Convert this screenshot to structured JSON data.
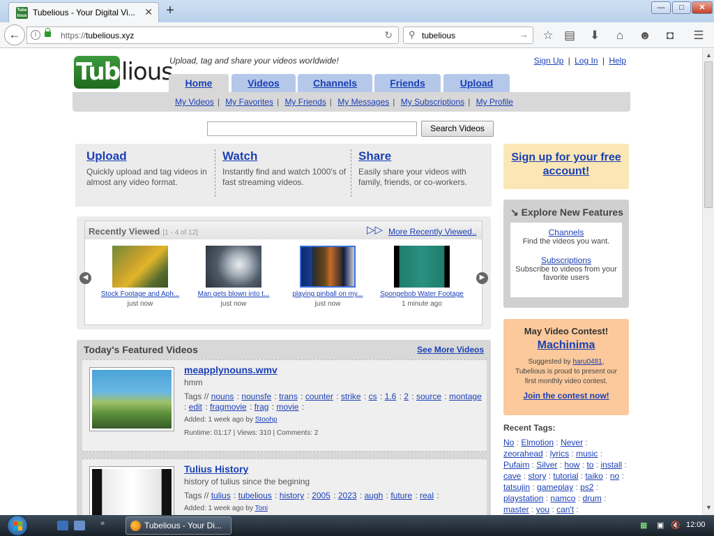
{
  "browser": {
    "tab_title": "Tubelious - Your Digital Vi...",
    "favicon_text": "Tube lious",
    "url_prefix": "https://",
    "url_host": "tubelious.xyz",
    "search_value": "tubelious",
    "window_buttons": {
      "minimize": "—",
      "maximize": "□",
      "close": "✕"
    }
  },
  "site": {
    "logo_left": "Tube",
    "logo_right": "lious",
    "tagline": "Upload, tag and share your videos worldwide!",
    "account": {
      "sign_up": "Sign Up",
      "log_in": "Log In",
      "help": "Help",
      "sep": "|"
    },
    "tabs": [
      "Home",
      "Videos",
      "Channels",
      "Friends",
      "Upload"
    ],
    "subnav": [
      "My Videos",
      "My Favorites",
      "My Friends",
      "My Messages",
      "My Subscriptions",
      "My Profile"
    ],
    "subnav_sep": "|",
    "search_button": "Search Videos",
    "search_value": ""
  },
  "intro": [
    {
      "title": "Upload",
      "text": "Quickly upload and tag videos in almost any video format."
    },
    {
      "title": "Watch",
      "text": "Instantly find and watch 1000's of fast streaming videos."
    },
    {
      "title": "Share",
      "text": "Easily share your videos with family, friends, or co-workers."
    }
  ],
  "recent": {
    "title": "Recently Viewed",
    "count": "[1 - 4 of 12]",
    "more": "More Recently Viewed..",
    "items": [
      {
        "title": "Stock Footage and Aph...",
        "time": "just now"
      },
      {
        "title": "Man gets blown into t...",
        "time": "just now"
      },
      {
        "title": "playing pinball on my...",
        "time": "just now"
      },
      {
        "title": "Spongebob Water Footage",
        "time": "1 minute ago"
      }
    ]
  },
  "featured": {
    "title": "Today's Featured Videos",
    "more": "See More Videos",
    "videos": [
      {
        "title": "meapplynouns.wmv",
        "desc": "hmm",
        "tags_label": "Tags //",
        "tags": [
          "nouns",
          "nounsfe",
          "trans",
          "counter",
          "strike",
          "cs",
          "1.6",
          "2",
          "source",
          "montage",
          "edit",
          "fragmovie",
          "frag",
          "movie"
        ],
        "added_prefix": "Added: 1 week ago by",
        "author": "Stoohp",
        "stats": "Runtime: 01:17 | Views: 310 | Comments: 2"
      },
      {
        "title": "Tulius History",
        "desc": "history of tulius since the begining",
        "tags_label": "Tags //",
        "tags": [
          "tulius",
          "tubelious",
          "history",
          "2005",
          "2023",
          "augh",
          "future",
          "real"
        ],
        "added_prefix": "Added: 1 week ago by",
        "author": "Toni",
        "stats": ""
      }
    ]
  },
  "sidebar": {
    "signup": "Sign up for your free account!",
    "explore_title": "Explore New Features",
    "explore_items": [
      {
        "link": "Channels",
        "text": "Find the videos you want."
      },
      {
        "link": "Subscriptions",
        "text": "Subscribe to videos from your favorite users"
      }
    ],
    "contest_title": "May Video Contest!",
    "contest_name": "Machinima",
    "contest_desc_prefix": "Suggested by",
    "contest_user": "haru0481",
    "contest_desc_rest": "Tubelious is proud to present our first monthly video contest.",
    "contest_join": "Join the contest now!",
    "recent_tags_title": "Recent Tags:",
    "recent_tags": [
      "No",
      "Elmotion",
      "Never",
      "zeorahead",
      "lyrics",
      "music",
      "Pufaim",
      "Silver",
      "how",
      "to",
      "install",
      "cave",
      "story",
      "tutorial",
      "taiko",
      "no",
      "tatsujin",
      "gameplay",
      "ps2",
      "playstation",
      "namco",
      "drum",
      "master",
      "you",
      "can't"
    ]
  },
  "taskbar": {
    "task_label": "Tubelious - Your Di...",
    "clock": "12:00"
  }
}
